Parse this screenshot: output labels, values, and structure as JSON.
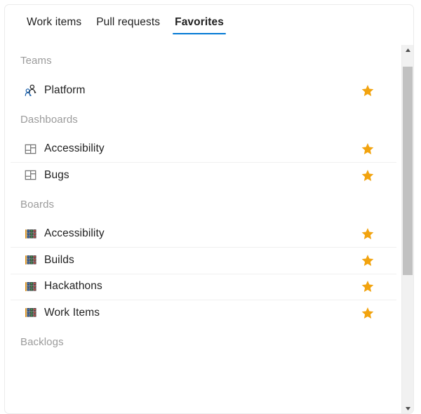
{
  "tabs": [
    {
      "label": "Work items",
      "active": false
    },
    {
      "label": "Pull requests",
      "active": false
    },
    {
      "label": "Favorites",
      "active": true
    }
  ],
  "colors": {
    "accent": "#0078d4",
    "star": "#f2a30e",
    "section_header": "#9b9b9b",
    "text": "#1f1f1f",
    "separator": "#f0f0f0",
    "scrollbar_thumb": "#c1c1c1",
    "scrollbar_track": "#f1f1f1",
    "card_border": "#ebebeb"
  },
  "sections": [
    {
      "title": "Teams",
      "items": [
        {
          "label": "Platform",
          "icon": "team-icon",
          "favorite": true,
          "star_icon": "star-filled-icon"
        }
      ]
    },
    {
      "title": "Dashboards",
      "items": [
        {
          "label": "Accessibility",
          "icon": "dashboard-icon",
          "favorite": true,
          "star_icon": "star-filled-icon"
        },
        {
          "label": "Bugs",
          "icon": "dashboard-icon",
          "favorite": true,
          "star_icon": "star-filled-icon"
        }
      ]
    },
    {
      "title": "Boards",
      "items": [
        {
          "label": "Accessibility",
          "icon": "board-icon",
          "favorite": true,
          "star_icon": "star-filled-icon"
        },
        {
          "label": "Builds",
          "icon": "board-icon",
          "favorite": true,
          "star_icon": "star-filled-icon"
        },
        {
          "label": "Hackathons",
          "icon": "board-icon",
          "favorite": true,
          "star_icon": "star-filled-icon"
        },
        {
          "label": "Work Items",
          "icon": "board-icon",
          "favorite": true,
          "star_icon": "star-filled-icon"
        }
      ]
    },
    {
      "title": "Backlogs",
      "items": []
    }
  ],
  "scrollbar": {
    "up_icon": "caret-up-icon",
    "down_icon": "caret-down-icon",
    "thumb_top_pct": 3,
    "thumb_height_pct": 60
  }
}
